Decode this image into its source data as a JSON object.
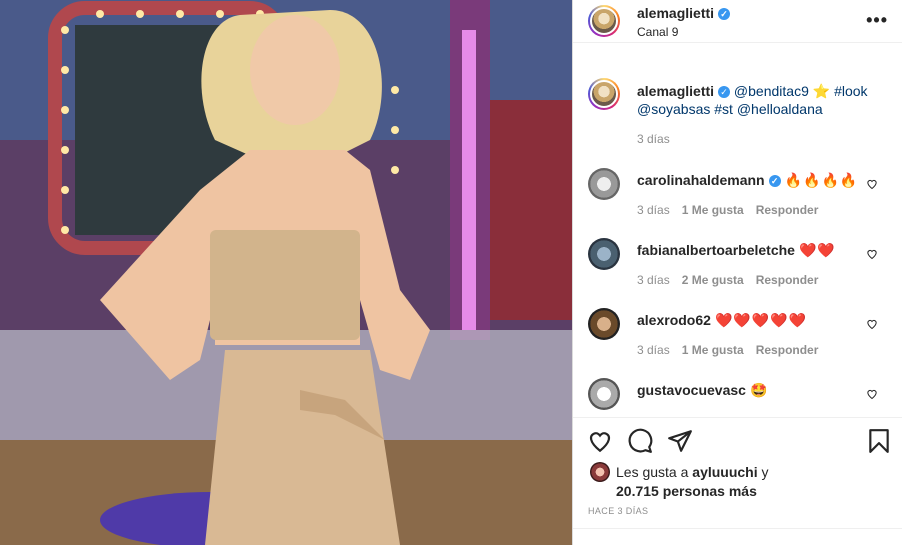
{
  "post": {
    "author": "alemaglietti",
    "location": "Canal 9",
    "more_label": "•••",
    "caption_parts": [
      "@benditac9",
      "⭐",
      "#look",
      "@soyabsas",
      "#st",
      "@helloaldana"
    ],
    "caption_time": "3 días"
  },
  "comments": [
    {
      "user": "carolinahaldemann",
      "verified": true,
      "text": "🔥🔥🔥🔥",
      "time": "3 días",
      "likes": "1 Me gusta",
      "reply": "Responder"
    },
    {
      "user": "fabianalbertoarbeletche",
      "verified": false,
      "text": "❤️❤️",
      "time": "3 días",
      "likes": "2 Me gusta",
      "reply": "Responder"
    },
    {
      "user": "alexrodo62",
      "verified": false,
      "text": "❤️❤️❤️❤️❤️",
      "time": "3 días",
      "likes": "1 Me gusta",
      "reply": "Responder"
    },
    {
      "user": "gustavocuevasc",
      "verified": false,
      "text": "🤩",
      "time": "",
      "likes": "",
      "reply": ""
    }
  ],
  "likes": {
    "prefix": "Les gusta a",
    "user": "ayluuuchi",
    "joiner": "y",
    "count_text": "20.715 personas más"
  },
  "posted_ago": "HACE 3 DÍAS",
  "icons": [
    "heart-icon",
    "comment-icon",
    "share-icon",
    "bookmark-icon",
    "more-icon",
    "verified-icon"
  ],
  "colors": {
    "verified": "#3897f0",
    "link": "#00376b",
    "muted": "#8e8e8e",
    "text": "#262626"
  }
}
